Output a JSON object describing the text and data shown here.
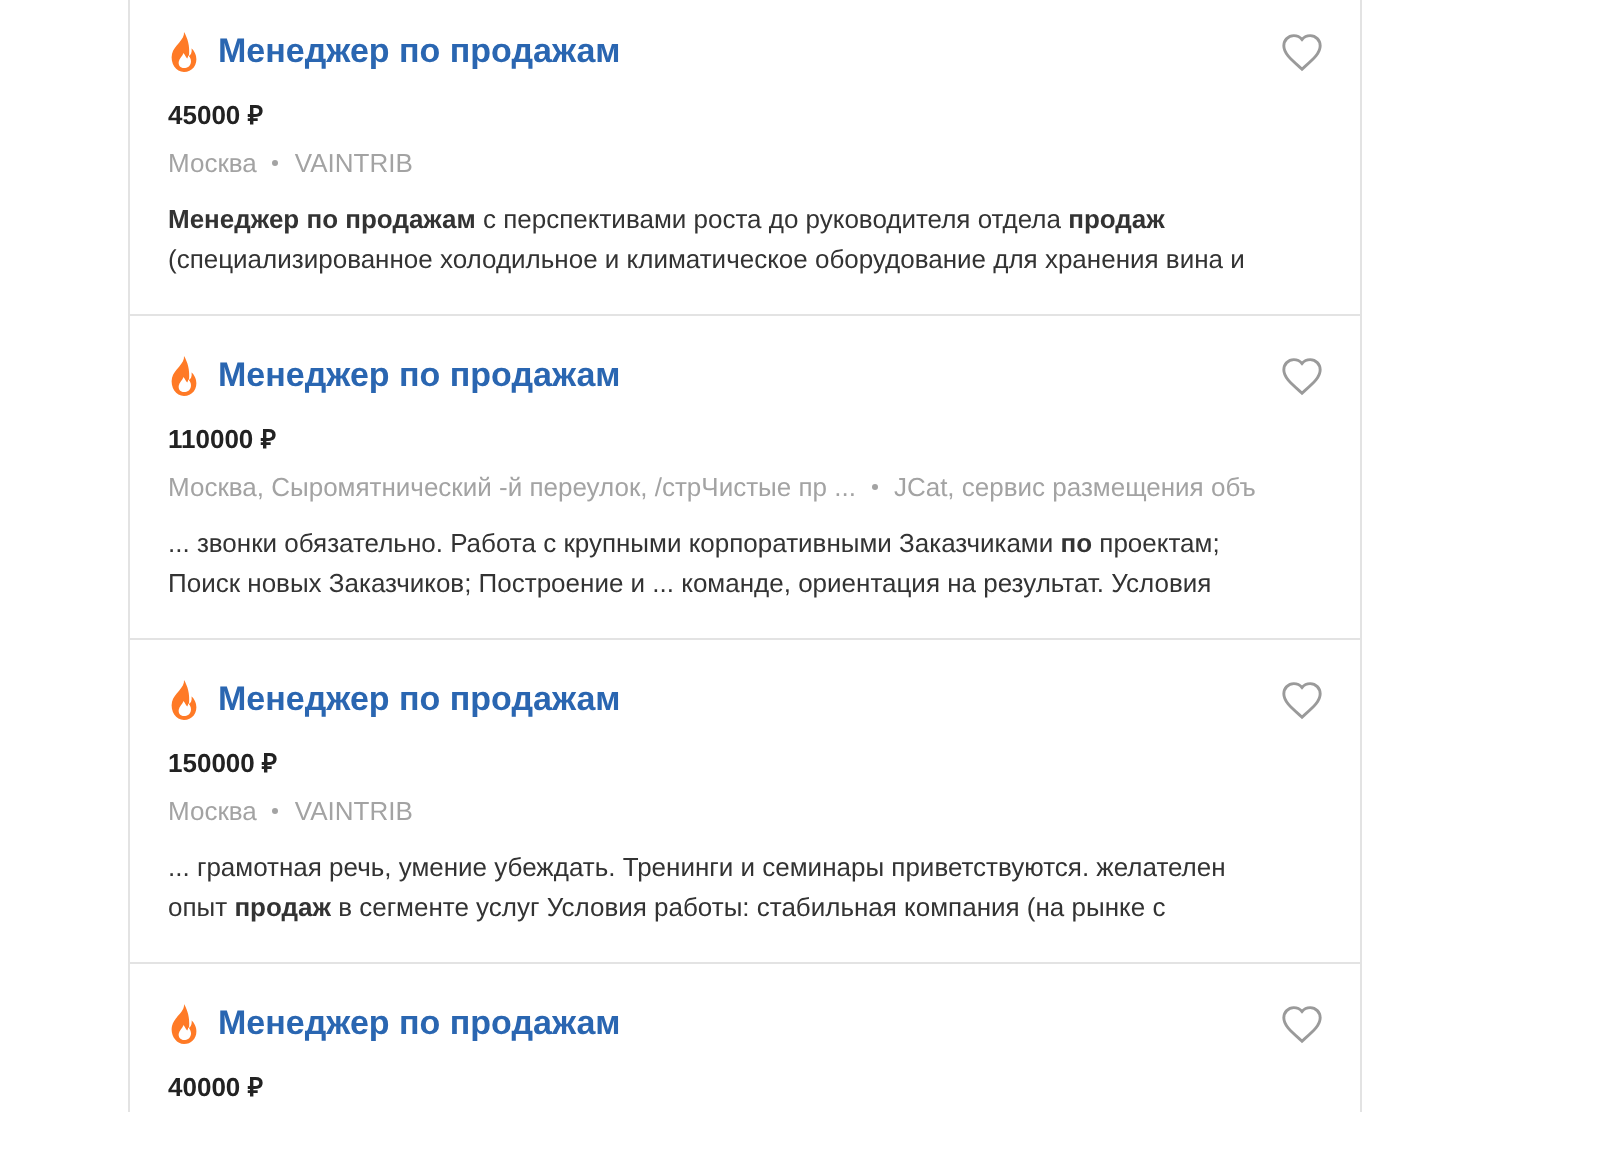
{
  "vacancies": [
    {
      "title": "Менеджер по продажам",
      "salary": "45000 ₽",
      "location": "Москва",
      "company": "VAINTRIB",
      "snippet": [
        "**Менеджер по продажам** с перспективами роста до руководителя отдела **продаж**",
        "(специализированное холодильное и климатическое оборудование для хранения вина и"
      ]
    },
    {
      "title": "Менеджер по продажам",
      "salary": "110000 ₽",
      "location": "Москва, Сыромятнический -й переулок, /стрЧистые пр ...",
      "company": "JCat, сервис размещения объ",
      "snippet": [
        "... звонки обязательно. Работа с крупными корпоративными Заказчиками **по** проектам;",
        "Поиск новых Заказчиков; Построение и ... команде, ориентация на результат.  Условия"
      ]
    },
    {
      "title": "Менеджер по продажам",
      "salary": "150000 ₽",
      "location": "Москва",
      "company": "VAINTRIB",
      "snippet": [
        "... грамотная речь, умение убеждать. Тренинги и семинары приветствуются. желателен",
        "опыт **продаж** в сегменте услуг Условия работы: стабильная компания (на рынке с"
      ]
    },
    {
      "title": "Менеджер по продажам",
      "salary": "40000 ₽"
    }
  ]
}
